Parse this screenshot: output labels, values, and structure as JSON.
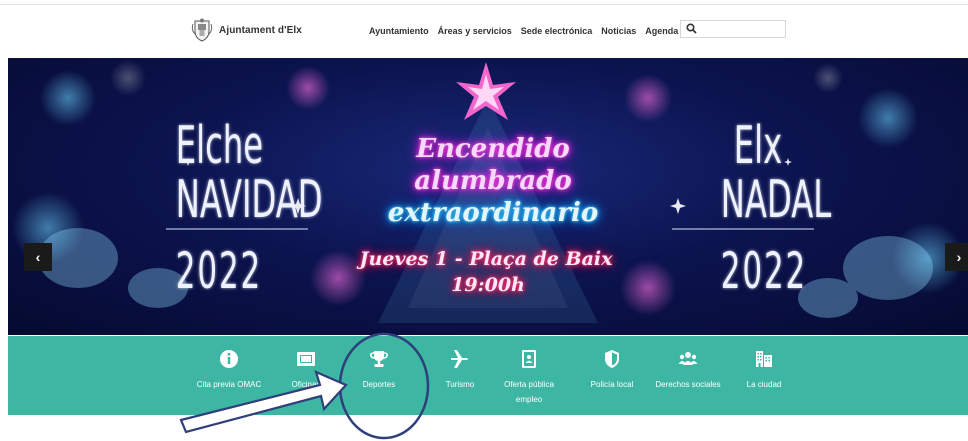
{
  "header": {
    "logo_text": "Ajuntament d'Elx",
    "nav": [
      "Ayuntamiento",
      "Áreas y servicios",
      "Sede electrónica",
      "Noticias",
      "Agenda"
    ],
    "search_placeholder": ""
  },
  "hero": {
    "left_title": [
      "Elche",
      "NAVIDAD",
      "2022"
    ],
    "right_title": [
      "Elx",
      "NADAL",
      "2022"
    ],
    "neon_lines": [
      "Encendido",
      "alumbrado",
      "extraordinario",
      "Jueves 1 - Plaça de Baix",
      "19:00h"
    ],
    "prev_arrow": "‹",
    "next_arrow": "›",
    "slide_count": 7,
    "active_slide": 6
  },
  "services": [
    {
      "label": "Cita previa OMAC",
      "icon": "info-icon"
    },
    {
      "label": "Oficinas",
      "icon": "id-card-icon"
    },
    {
      "label": "Deportes",
      "icon": "trophy-icon"
    },
    {
      "label": "Turismo",
      "icon": "plane-icon"
    },
    {
      "label": "Oferta pública empleo",
      "icon": "contact-book-icon"
    },
    {
      "label": "Policía local",
      "icon": "shield-icon"
    },
    {
      "label": "Derechos sociales",
      "icon": "users-icon"
    },
    {
      "label": "La ciudad",
      "icon": "building-icon"
    }
  ],
  "colors": {
    "service_bar": "#3db6a3",
    "annotation": "#2e3f7a"
  }
}
